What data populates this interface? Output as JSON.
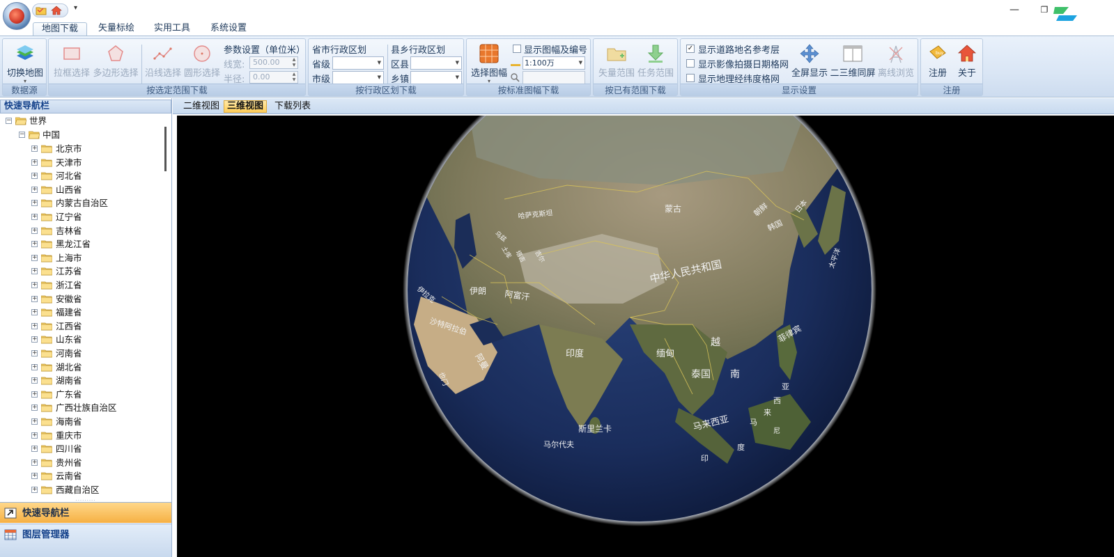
{
  "ribbon": {
    "tabs": [
      {
        "label": "地图下载",
        "active": true
      },
      {
        "label": "矢量标绘",
        "active": false
      },
      {
        "label": "实用工具",
        "active": false
      },
      {
        "label": "系统设置",
        "active": false
      }
    ],
    "groups": {
      "datasource": {
        "label": "数据源",
        "switch_map": "切换地图"
      },
      "range_download": {
        "label": "按选定范围下载",
        "rect_select": "拉框选择",
        "polygon_select": "多边形选择",
        "line_select": "沿线选择",
        "circle_select": "圆形选择",
        "params_title": "参数设置（单位米）",
        "line_width_label": "线宽:",
        "line_width_value": "500.00",
        "radius_label": "半径:",
        "radius_value": "0.00"
      },
      "admin_download": {
        "label": "按行政区划下载",
        "province_city_title": "省市行政区划",
        "province_label": "省级",
        "city_label": "市级",
        "county_town_title": "县乡行政区划",
        "county_label": "区县",
        "town_label": "乡镇"
      },
      "sheet_download": {
        "label": "按标准图幅下载",
        "select_sheet": "选择图幅",
        "show_sheet_label": "显示图幅及编号",
        "scale_value": "1:100万"
      },
      "existing_range": {
        "label": "按已有范围下载",
        "vector_range": "矢量范围",
        "task_range": "任务范围"
      },
      "display": {
        "label": "显示设置",
        "show_road_names": "显示道路地名参考层",
        "show_road_names_checked": true,
        "show_image_dates": "显示影像拍摄日期格网",
        "show_image_dates_checked": false,
        "show_latlon_grid": "显示地理经纬度格网",
        "show_latlon_grid_checked": false,
        "fullscreen": "全屏显示",
        "split_2d3d": "二三维同屏",
        "offline_browse": "离线浏览"
      },
      "register": {
        "label": "注册",
        "register_btn": "注册",
        "about_btn": "关于"
      }
    }
  },
  "left_panel": {
    "header": "快速导航栏",
    "tree": {
      "root": "世界",
      "country": "中国",
      "provinces": [
        "北京市",
        "天津市",
        "河北省",
        "山西省",
        "内蒙古自治区",
        "辽宁省",
        "吉林省",
        "黑龙江省",
        "上海市",
        "江苏省",
        "浙江省",
        "安徽省",
        "福建省",
        "江西省",
        "山东省",
        "河南省",
        "湖北省",
        "湖南省",
        "广东省",
        "广西壮族自治区",
        "海南省",
        "重庆市",
        "四川省",
        "贵州省",
        "云南省",
        "西藏自治区"
      ]
    },
    "bottom_tabs": {
      "nav": "快速导航栏",
      "layers": "图层管理器"
    }
  },
  "view_tabs": [
    {
      "label": "二维视图",
      "active": false
    },
    {
      "label": "三维视图",
      "active": true
    },
    {
      "label": "下载列表",
      "active": false
    }
  ],
  "globe_labels": {
    "china": "中华人民共和国",
    "mongolia": "蒙古",
    "kazakhstan": "哈萨克斯坦",
    "india": "印度",
    "myanmar": "缅甸",
    "thailand": "泰国",
    "vietnam_1": "越",
    "vietnam_2": "南",
    "malaysia": "马来西亚",
    "philippines": "菲律宾",
    "korea_north": "朝鲜",
    "korea_south": "韩国",
    "japan": "日本",
    "pacific": "太平洋",
    "iran": "伊朗",
    "afghanistan": "阿富汗",
    "saudi": "沙特阿拉伯",
    "oman": "阿曼",
    "sri_lanka": "斯里兰卡",
    "maldives": "马尔代夫",
    "indonesia_1": "印",
    "indonesia_2": "度",
    "malaysia_e1": "马",
    "malaysia_e2": "来",
    "malaysia_e3": "西",
    "malaysia_e4": "亚",
    "indonesia_e": "尼",
    "yemen": "也门",
    "iraq": "伊拉克",
    "uzbek": "乌兹",
    "turkmen": "土库",
    "tajik": "塔吉",
    "kyrgyz": "吉尔"
  },
  "colors": {
    "ribbon_bg": "#dae6f5",
    "active_doc_tab": "#ffce5a",
    "nav_tab_active": "#f6b043",
    "globe_ocean": "#1a2d5c",
    "view_bg": "#000000"
  }
}
